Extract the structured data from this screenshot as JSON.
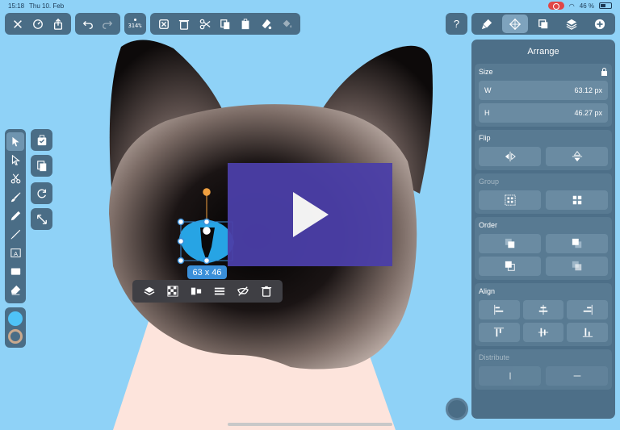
{
  "status_bar": {
    "time": "15:18",
    "date": "Thu 10. Feb",
    "battery": "46 %"
  },
  "toolbar": {
    "zoom_label": "314%",
    "buttons_left": [
      "close-icon",
      "settings-icon",
      "share-icon"
    ],
    "buttons_history": [
      "undo-icon",
      "redo-icon"
    ],
    "buttons_edit": [
      "delete-selection-icon",
      "trash-icon",
      "scissors-icon",
      "copy-icon",
      "paste-icon",
      "fill-icon",
      "paint-bucket-icon"
    ]
  },
  "help_label": "?",
  "right_tabs": [
    "style-brush-icon",
    "arrange-icon",
    "pathfinder-icon",
    "layers-icon",
    "add-icon"
  ],
  "left_tools": [
    "select-icon",
    "direct-select-icon",
    "scissors-tool-icon",
    "brush-icon",
    "pencil-icon",
    "pen-icon",
    "text-icon",
    "rectangle-icon",
    "eraser-icon"
  ],
  "text_tool_glyph": "A",
  "sub_tools": [
    "snap-icon",
    "clone-icon",
    "rotate-icon",
    "resize-icon"
  ],
  "colors": {
    "fill": "#4fc3f7",
    "stroke": "#c9a98e",
    "accent": "#3a8fd9"
  },
  "selection": {
    "size_label": "63 x 46"
  },
  "context_menu": [
    "layers-icon",
    "checker-icon",
    "distribute-icon",
    "align-icon",
    "mask-icon",
    "trash-icon"
  ],
  "panel": {
    "title": "Arrange",
    "size": {
      "title": "Size",
      "w_label": "W",
      "w_value": "63.12 px",
      "h_label": "H",
      "h_value": "46.27 px"
    },
    "flip_title": "Flip",
    "group_title": "Group",
    "order_title": "Order",
    "align_title": "Align",
    "distribute_title": "Distribute"
  }
}
